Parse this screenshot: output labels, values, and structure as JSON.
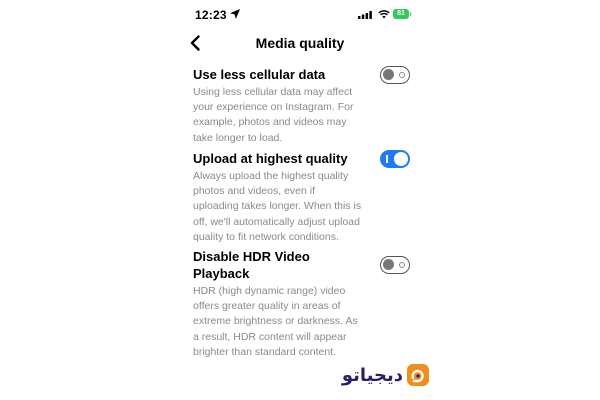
{
  "status_bar": {
    "time": "12:23",
    "battery": "81",
    "icons": [
      "location-arrow-icon",
      "signal-icon",
      "wifi-icon",
      "battery-icon"
    ],
    "battery_color": "#34c759"
  },
  "nav": {
    "title": "Media quality",
    "back_icon": "chevron-left-icon"
  },
  "settings": [
    {
      "title": "Use less cellular data",
      "description": "Using less cellular data may affect your experience on Instagram. For example, photos and videos may take longer to load.",
      "enabled": false
    },
    {
      "title": "Upload at highest quality",
      "description": "Always upload the highest quality photos and videos, even if uploading takes longer. When this is off, we'll automatically adjust upload quality to fit network conditions.",
      "enabled": true
    },
    {
      "title": "Disable HDR Video Playback",
      "description": "HDR (high dynamic range) video offers greater quality in areas of extreme brightness or darkness. As a result, HDR content will appear brighter than standard content.",
      "enabled": false
    }
  ],
  "colors": {
    "toggle_on": "#1d7cf2",
    "secondary_text": "#8a8a8a",
    "logo_primary": "#2b1e6b",
    "logo_accent": "#f28c1b"
  },
  "watermark": {
    "text": "دیجیاتو"
  }
}
